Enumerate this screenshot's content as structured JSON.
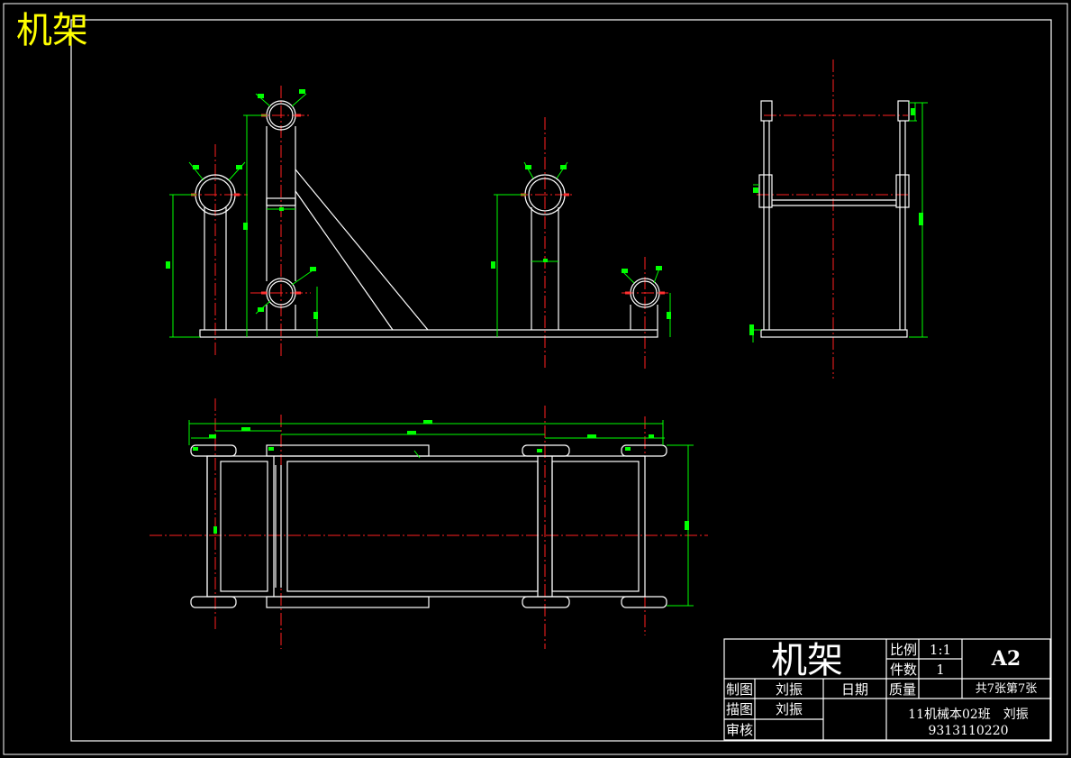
{
  "drawing": {
    "corner_title": "机架",
    "title_block": {
      "title": "机架",
      "scale_label": "比例",
      "scale_value": "1:1",
      "qty_label": "件数",
      "qty_value": "1",
      "sheet_size": "A2",
      "drawn_label": "制图",
      "drawn_by": "刘振",
      "date_label": "日期",
      "mass_label": "质量",
      "sheet_info": "共7张第7张",
      "traced_label": "描图",
      "traced_by": "刘振",
      "review_label": "审核",
      "class_info": "11机械本02班　刘振",
      "student_id": "9313110220"
    }
  },
  "colors": {
    "background": "#000000",
    "geometry": "#ffffff",
    "dimension": "#00ff00",
    "centerline": "#ff0000",
    "title_text": "#ffff00"
  }
}
